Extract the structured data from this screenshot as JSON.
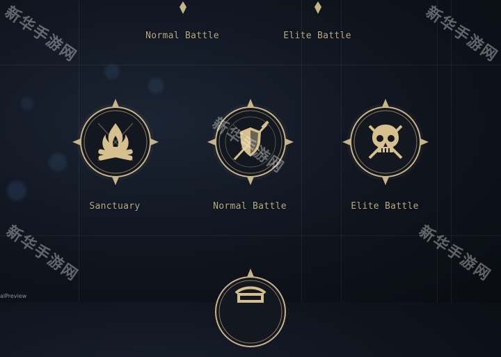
{
  "top_labels": [
    "Normal Battle",
    "Elite Battle"
  ],
  "row_labels": [
    "Sanctuary",
    "Normal Battle",
    "Elite Battle"
  ],
  "watermark_text": "新华手游网",
  "corner_text": "alPreview",
  "colors": {
    "label": "#b9ab86",
    "ring": "#c9b48a",
    "icon": "#d6c08e",
    "node_fill": "#141922"
  }
}
